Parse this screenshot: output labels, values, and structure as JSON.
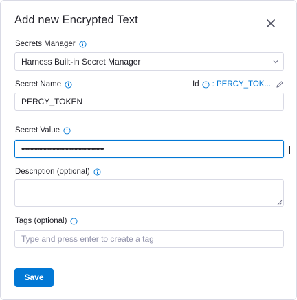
{
  "dialog": {
    "title": "Add new Encrypted Text",
    "close_icon": "close-icon"
  },
  "secrets_manager": {
    "label": "Secrets Manager",
    "value": "Harness Built-in Secret Manager"
  },
  "secret_name": {
    "label": "Secret Name",
    "value": "PERCY_TOKEN",
    "id_label": "Id",
    "id_value": ": PERCY_TOK..."
  },
  "secret_value": {
    "label": "Secret Value",
    "masked": "••••••••••••••••••••••••••••••••••••••••••••••••••••••••"
  },
  "description": {
    "label": "Description (optional)",
    "value": ""
  },
  "tags": {
    "label": "Tags (optional)",
    "placeholder": "Type and press enter to create a tag"
  },
  "actions": {
    "save_label": "Save"
  },
  "colors": {
    "accent": "#0278d5",
    "border": "#d9dae5",
    "text": "#22222a",
    "placeholder": "#9293ab"
  }
}
